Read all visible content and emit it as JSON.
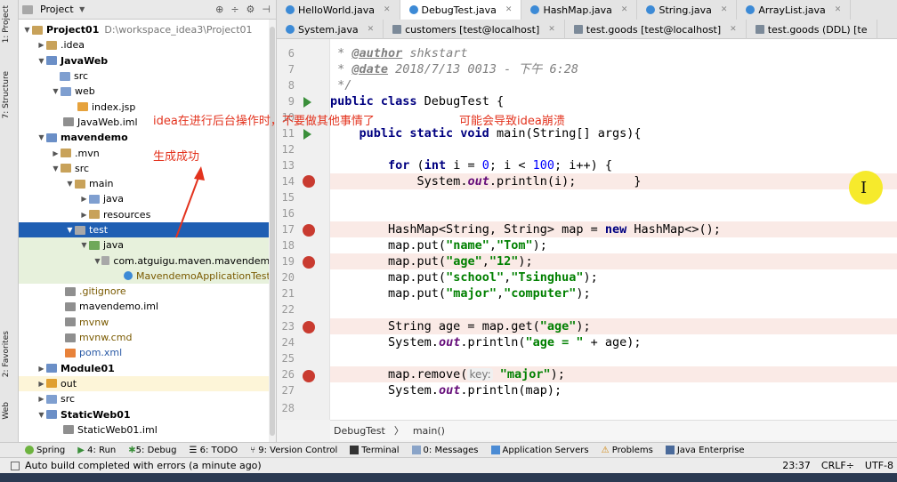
{
  "sidebar": {
    "project_tab": "1: Project",
    "structure_tab": "7: Structure",
    "favorites_tab": "2: Favorites",
    "web_tab": "Web"
  },
  "project_panel": {
    "title": "Project",
    "tree": [
      {
        "label": "Project01",
        "path": "D:\\workspace_idea3\\Project01"
      },
      {
        "label": ".idea"
      },
      {
        "label": "JavaWeb"
      },
      {
        "label": "src"
      },
      {
        "label": "web"
      },
      {
        "label": "index.jsp"
      },
      {
        "label": "JavaWeb.iml"
      },
      {
        "label": "mavendemo"
      },
      {
        "label": ".mvn"
      },
      {
        "label": "src"
      },
      {
        "label": "main"
      },
      {
        "label": "java"
      },
      {
        "label": "resources"
      },
      {
        "label": "test"
      },
      {
        "label": "java"
      },
      {
        "label": "com.atguigu.maven.mavendemo"
      },
      {
        "label": "MavendemoApplicationTests"
      },
      {
        "label": ".gitignore"
      },
      {
        "label": "mavendemo.iml"
      },
      {
        "label": "mvnw"
      },
      {
        "label": "mvnw.cmd"
      },
      {
        "label": "pom.xml"
      },
      {
        "label": "Module01"
      },
      {
        "label": "out"
      },
      {
        "label": "src"
      },
      {
        "label": "StaticWeb01"
      },
      {
        "label": "StaticWeb01.iml"
      }
    ]
  },
  "tabs": {
    "row1": [
      "HelloWorld.java",
      "DebugTest.java",
      "HashMap.java",
      "String.java",
      "ArrayList.java"
    ],
    "row2": [
      "System.java",
      "customers [test@localhost]",
      "test.goods [test@localhost]",
      "test.goods (DDL) [te"
    ]
  },
  "editor": {
    "line_numbers": [
      "6",
      "7",
      "8",
      "9",
      "10",
      "11",
      "12",
      "13",
      "14",
      "15",
      "16",
      "17",
      "18",
      "19",
      "20",
      "21",
      "22",
      "23",
      "24",
      "25",
      "26",
      "27",
      "28"
    ],
    "author_tag": "@author",
    "author_val": " shkstart",
    "date_tag": "@date",
    "date_val": " 2018/7/13 0013 - 下午 6:28",
    "comment_end": "*/",
    "class_decl_kw": "public class",
    "class_name": " DebugTest {",
    "main_kw": "public static void",
    "main_sig": " main(String[] args){",
    "for_kw": "for",
    "for_int": "int",
    "for_rest1": " i = ",
    "for_zero": "0",
    "for_rest2": "; i < ",
    "for_hundred": "100",
    "for_rest3": "; i++) {",
    "print_i_a": "System.",
    "print_i_out": "out",
    "print_i_b": ".println(i);        }",
    "hashmap_a": "HashMap<String, String> map = ",
    "hashmap_new": "new",
    "hashmap_b": " HashMap<>();",
    "put1_a": "map.put(",
    "put1_k": "\"name\"",
    "put1_v": "\"Tom\"",
    "put2_k": "\"age\"",
    "put2_v": "\"12\"",
    "put3_k": "\"school\"",
    "put3_v": "\"Tsinghua\"",
    "put4_k": "\"major\"",
    "put4_v": "\"computer\"",
    "get_a": "String age = map.get(",
    "get_k": "\"age\"",
    "get_b": ");",
    "print_age_a": "System.",
    "print_age_b": ".println(",
    "print_age_s": "\"age = \"",
    "print_age_c": " + age);",
    "remove_a": "map.remove(",
    "remove_hint": "key:",
    "remove_k": "\"major\"",
    "remove_b": ");",
    "print_map_b": ".println(map);",
    "comma": ",",
    "close": ");"
  },
  "breadcrumb": {
    "class": "DebugTest",
    "method": "main()"
  },
  "annotations": {
    "warning": "idea在进行后台操作时，不要做其他事情了",
    "crash": "可能会导致idea崩溃",
    "success": "生成成功"
  },
  "toolbar": {
    "items": [
      "Spring",
      "4: Run",
      "5: Debug",
      "6: TODO",
      "9: Version Control",
      "Terminal",
      "0: Messages",
      "Application Servers",
      "Problems",
      "Java Enterprise"
    ]
  },
  "status": {
    "message": "Auto build completed with errors (a minute ago)",
    "position": "23:37",
    "line_sep": "CRLF÷",
    "encoding": "UTF-8"
  },
  "colors": {
    "accent_selection": "#1f5fb3",
    "breakpoint": "#c93b30",
    "annotation": "#e3331e"
  }
}
